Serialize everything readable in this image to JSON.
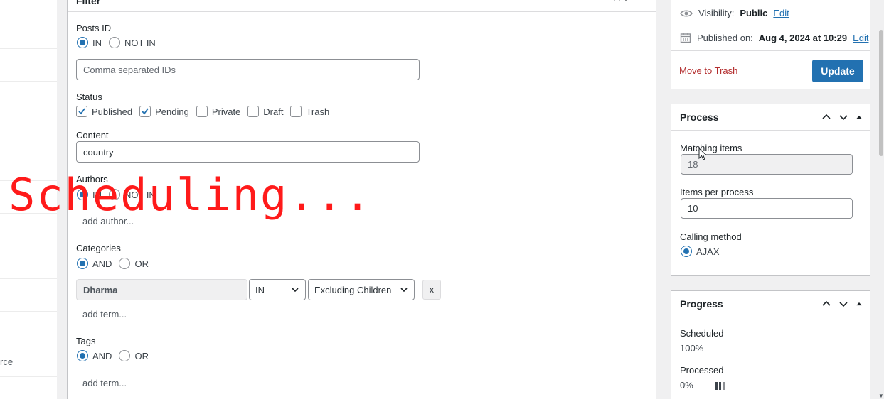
{
  "sidebar": {
    "partial_label": "rce"
  },
  "filter": {
    "title": "Filter",
    "posts_id": {
      "label": "Posts ID",
      "options": [
        "IN",
        "NOT IN"
      ],
      "selected": "IN",
      "placeholder": "Comma separated IDs"
    },
    "status": {
      "label": "Status",
      "options": [
        {
          "label": "Published",
          "checked": true
        },
        {
          "label": "Pending",
          "checked": true
        },
        {
          "label": "Private",
          "checked": false
        },
        {
          "label": "Draft",
          "checked": false
        },
        {
          "label": "Trash",
          "checked": false
        }
      ]
    },
    "content": {
      "label": "Content",
      "value": "country"
    },
    "authors": {
      "label": "Authors",
      "options": [
        "IN",
        "NOT IN"
      ],
      "selected": "IN",
      "add_link": "add author..."
    },
    "categories": {
      "label": "Categories",
      "options": [
        "AND",
        "OR"
      ],
      "selected": "AND",
      "term": "Dharma",
      "operator": "IN",
      "children": "Excluding Children",
      "remove": "x",
      "add_link": "add term..."
    },
    "tags": {
      "label": "Tags",
      "options": [
        "AND",
        "OR"
      ],
      "selected": "AND",
      "add_link": "add term..."
    }
  },
  "publish": {
    "visibility_label": "Visibility:",
    "visibility_value": "Public",
    "published_label": "Published on:",
    "published_value": "Aug 4, 2024 at 10:29",
    "edit_link": "Edit",
    "trash_link": "Move to Trash",
    "update_button": "Update"
  },
  "process": {
    "title": "Process",
    "matching_label": "Matching items",
    "matching_value": "18",
    "per_process_label": "Items per process",
    "per_process_value": "10",
    "method_label": "Calling method",
    "method_value": "AJAX"
  },
  "progress": {
    "title": "Progress",
    "scheduled_label": "Scheduled",
    "scheduled_value": "100%",
    "processed_label": "Processed",
    "processed_value": "0%"
  },
  "overlay_text": "Scheduling...",
  "colors": {
    "accent": "#2271b1",
    "danger": "#b32d2e",
    "overlay": "#ff1a1a"
  }
}
